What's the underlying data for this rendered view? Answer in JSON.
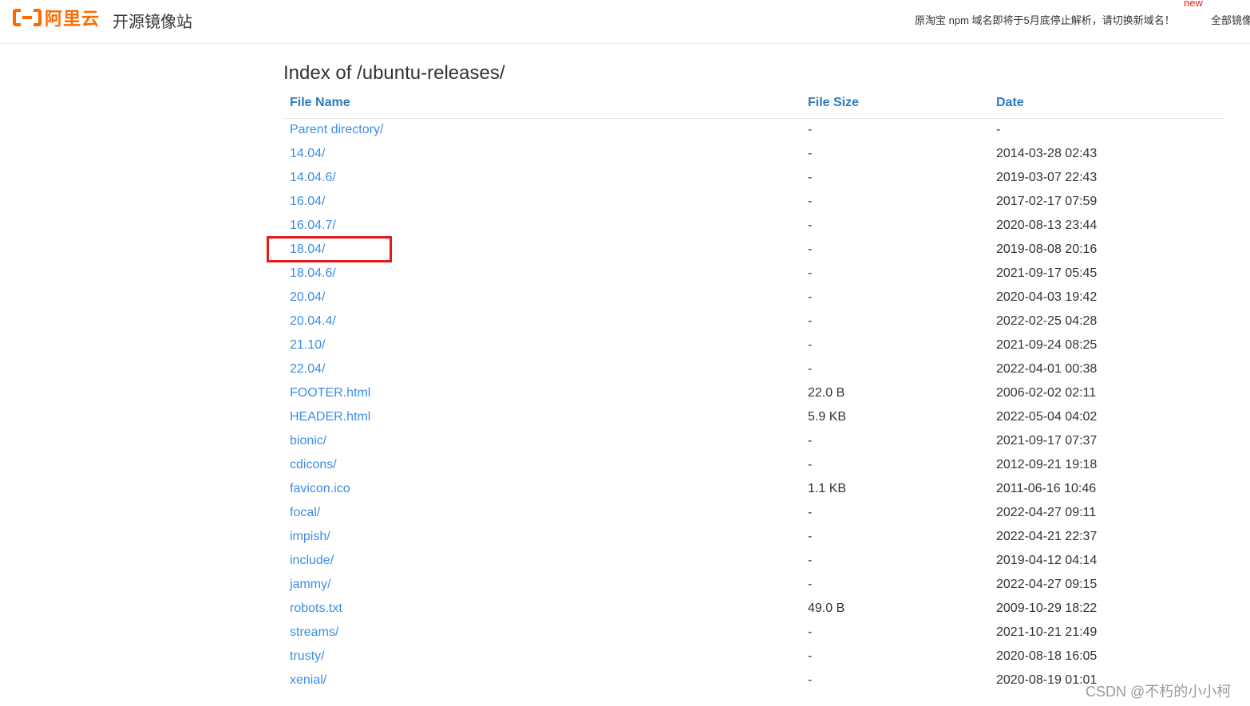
{
  "header": {
    "logo_text": "阿里云",
    "site_name": "开源镜像站",
    "notice": "原淘宝 npm 域名即将于5月底停止解析，请切换新域名！",
    "notice_badge": "new",
    "all_mirrors": "全部镜像"
  },
  "page": {
    "title": "Index of /ubuntu-releases/"
  },
  "table": {
    "headers": {
      "name": "File Name",
      "size": "File Size",
      "date": "Date"
    },
    "rows": [
      {
        "name": "Parent directory/",
        "size": "-",
        "date": "-"
      },
      {
        "name": "14.04/",
        "size": "-",
        "date": "2014-03-28 02:43"
      },
      {
        "name": "14.04.6/",
        "size": "-",
        "date": "2019-03-07 22:43"
      },
      {
        "name": "16.04/",
        "size": "-",
        "date": "2017-02-17 07:59"
      },
      {
        "name": "16.04.7/",
        "size": "-",
        "date": "2020-08-13 23:44"
      },
      {
        "name": "18.04/",
        "size": "-",
        "date": "2019-08-08 20:16"
      },
      {
        "name": "18.04.6/",
        "size": "-",
        "date": "2021-09-17 05:45"
      },
      {
        "name": "20.04/",
        "size": "-",
        "date": "2020-04-03 19:42"
      },
      {
        "name": "20.04.4/",
        "size": "-",
        "date": "2022-02-25 04:28"
      },
      {
        "name": "21.10/",
        "size": "-",
        "date": "2021-09-24 08:25"
      },
      {
        "name": "22.04/",
        "size": "-",
        "date": "2022-04-01 00:38"
      },
      {
        "name": "FOOTER.html",
        "size": "22.0 B",
        "date": "2006-02-02 02:11"
      },
      {
        "name": "HEADER.html",
        "size": "5.9 KB",
        "date": "2022-05-04 04:02"
      },
      {
        "name": "bionic/",
        "size": "-",
        "date": "2021-09-17 07:37"
      },
      {
        "name": "cdicons/",
        "size": "-",
        "date": "2012-09-21 19:18"
      },
      {
        "name": "favicon.ico",
        "size": "1.1 KB",
        "date": "2011-06-16 10:46"
      },
      {
        "name": "focal/",
        "size": "-",
        "date": "2022-04-27 09:11"
      },
      {
        "name": "impish/",
        "size": "-",
        "date": "2022-04-21 22:37"
      },
      {
        "name": "include/",
        "size": "-",
        "date": "2019-04-12 04:14"
      },
      {
        "name": "jammy/",
        "size": "-",
        "date": "2022-04-27 09:15"
      },
      {
        "name": "robots.txt",
        "size": "49.0 B",
        "date": "2009-10-29 18:22"
      },
      {
        "name": "streams/",
        "size": "-",
        "date": "2021-10-21 21:49"
      },
      {
        "name": "trusty/",
        "size": "-",
        "date": "2020-08-18 16:05"
      },
      {
        "name": "xenial/",
        "size": "-",
        "date": "2020-08-19 01:01"
      }
    ]
  },
  "watermark": "CSDN @不朽的小小柯",
  "colors": {
    "brand": "#ff6a00",
    "link": "#3a8ee6",
    "header_link": "#2a7bbf",
    "highlight": "#e3191b"
  }
}
